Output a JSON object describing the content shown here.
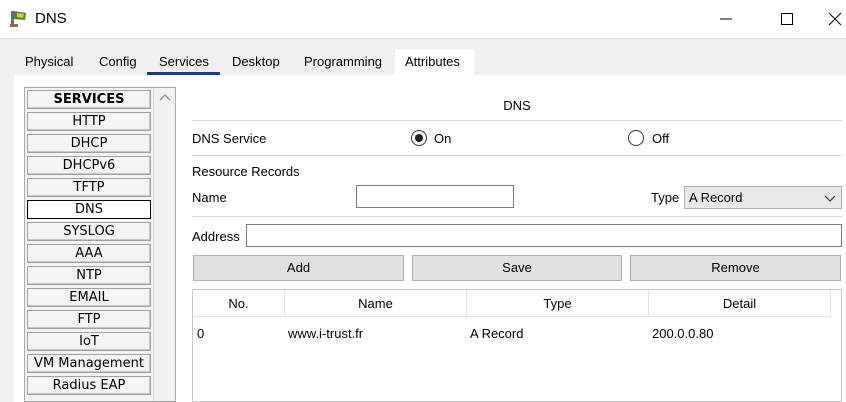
{
  "window": {
    "title": "DNS",
    "controls": {
      "minimize": "─",
      "maximize": "☐",
      "close": "✕"
    }
  },
  "tabs": [
    {
      "label": "Physical"
    },
    {
      "label": "Config"
    },
    {
      "label": "Services",
      "active": true
    },
    {
      "label": "Desktop"
    },
    {
      "label": "Programming"
    },
    {
      "label": "Attributes"
    }
  ],
  "services": {
    "header": "SERVICES",
    "items": [
      "HTTP",
      "DHCP",
      "DHCPv6",
      "TFTP",
      "DNS",
      "SYSLOG",
      "AAA",
      "NTP",
      "EMAIL",
      "FTP",
      "IoT",
      "VM Management",
      "Radius EAP"
    ],
    "selected": "DNS"
  },
  "dns": {
    "title": "DNS",
    "service_label": "DNS Service",
    "on_label": "On",
    "off_label": "Off",
    "service_state": "On",
    "resource_records_label": "Resource Records",
    "name_label": "Name",
    "name_value": "",
    "type_label": "Type",
    "type_value": "A Record",
    "address_label": "Address",
    "address_value": "",
    "buttons": {
      "add": "Add",
      "save": "Save",
      "remove": "Remove"
    },
    "table": {
      "columns": [
        "No.",
        "Name",
        "Type",
        "Detail"
      ],
      "rows": [
        {
          "no": "0",
          "name": "www.i-trust.fr",
          "type": "A Record",
          "detail": "200.0.0.80"
        }
      ]
    }
  },
  "colors": {
    "accent_underline": "#1f3d7a",
    "panel_bg": "#f0f0f0",
    "button_bg": "#e1e1e1"
  }
}
